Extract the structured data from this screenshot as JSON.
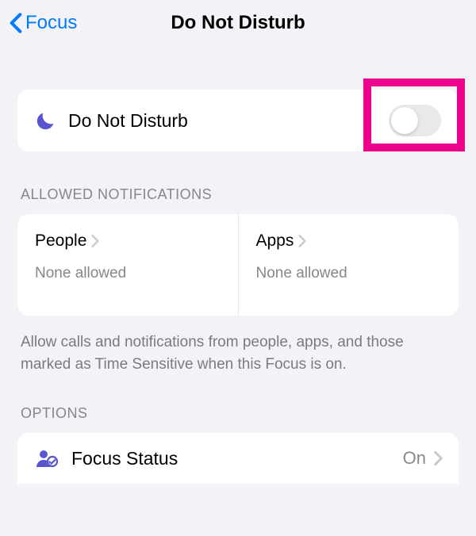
{
  "nav": {
    "back_label": "Focus",
    "title": "Do Not Disturb"
  },
  "dnd": {
    "label": "Do Not Disturb",
    "toggle_on": false
  },
  "sections": {
    "allowed_header": "ALLOWED NOTIFICATIONS",
    "options_header": "OPTIONS"
  },
  "allowed": {
    "people": {
      "title": "People",
      "subtitle": "None allowed"
    },
    "apps": {
      "title": "Apps",
      "subtitle": "None allowed"
    },
    "footer": "Allow calls and notifications from people, apps, and those marked as Time Sensitive when this Focus is on."
  },
  "focus_status": {
    "label": "Focus Status",
    "value": "On"
  },
  "colors": {
    "accent": "#5856cf",
    "highlight": "#ec008c"
  }
}
